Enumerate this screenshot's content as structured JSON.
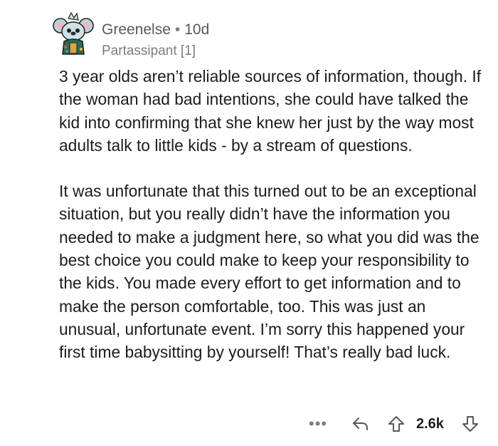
{
  "comment": {
    "author": "Greenelse",
    "separator": "•",
    "age": "10d",
    "flair": "Partassipant [1]",
    "paragraphs": [
      "3 year olds aren’t reliable sources of information, though. If the woman had bad intentions, she could have talked the kid into confirming that she knew her just by the way most adults talk to little kids - by a stream of questions.",
      "It was unfortunate that this turned out to be an exceptional situation, but you really didn’t have the information you needed to make a judgment here, so what you did was the best choice you could make to keep your responsibility to the kids. You made every effort to get information and to make the person comfortable, too. This was just an unusual, unfortunate event. I’m sorry this happened your first time babysitting by yourself! That’s really bad luck."
    ]
  },
  "actions": {
    "more_label": "•••",
    "score": "2.6k",
    "reply_icon": "reply-arrow-icon",
    "upvote_icon": "upvote-arrow-icon",
    "downvote_icon": "downvote-arrow-icon"
  },
  "colors": {
    "text": "#1c1c1c",
    "meta": "#555a5f",
    "muted": "#7c7c7c",
    "avatar_body": "#4a9fb8",
    "avatar_jacket": "#2b6b57"
  }
}
